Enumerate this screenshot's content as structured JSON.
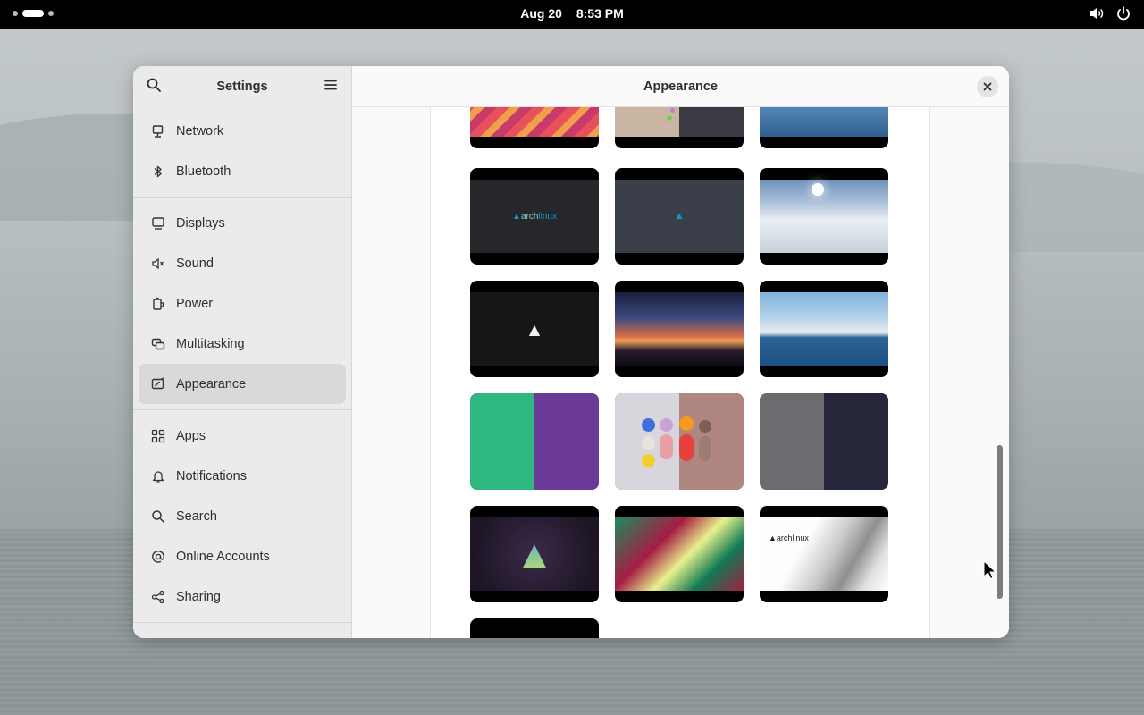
{
  "topbar": {
    "date": "Aug 20",
    "time": "8:53 PM",
    "icons": [
      "activities-indicator",
      "volume-icon",
      "power-icon"
    ]
  },
  "sidebar": {
    "title": "Settings",
    "items": [
      {
        "label": "Network",
        "icon": "network-icon"
      },
      {
        "label": "Bluetooth",
        "icon": "bluetooth-icon"
      },
      {
        "label": "Displays",
        "icon": "display-icon"
      },
      {
        "label": "Sound",
        "icon": "speaker-icon"
      },
      {
        "label": "Power",
        "icon": "battery-icon"
      },
      {
        "label": "Multitasking",
        "icon": "multitasking-icon"
      },
      {
        "label": "Appearance",
        "icon": "appearance-icon",
        "active": true
      },
      {
        "label": "Apps",
        "icon": "apps-grid-icon"
      },
      {
        "label": "Notifications",
        "icon": "bell-icon"
      },
      {
        "label": "Search",
        "icon": "search-icon"
      },
      {
        "label": "Online Accounts",
        "icon": "at-icon"
      },
      {
        "label": "Sharing",
        "icon": "share-icon"
      }
    ]
  },
  "main": {
    "title": "Appearance"
  },
  "wallpapers": [
    "pink-orange-pattern",
    "sand-dark-split",
    "ice-water",
    "archlinux-dark",
    "archlinux-slate",
    "snow-valley",
    "arch-black-lines",
    "sunset-clouds",
    "glacier-sea",
    "green-purple-split",
    "colorful-spheres",
    "gray-navy-split",
    "arch-purple-gradient",
    "green-red-abstract",
    "archlinux-metal",
    "black-partial"
  ],
  "colors": {
    "accent": "#3584e4",
    "sidebar_bg": "#ebebeb",
    "active_bg": "#d9d9d9"
  }
}
